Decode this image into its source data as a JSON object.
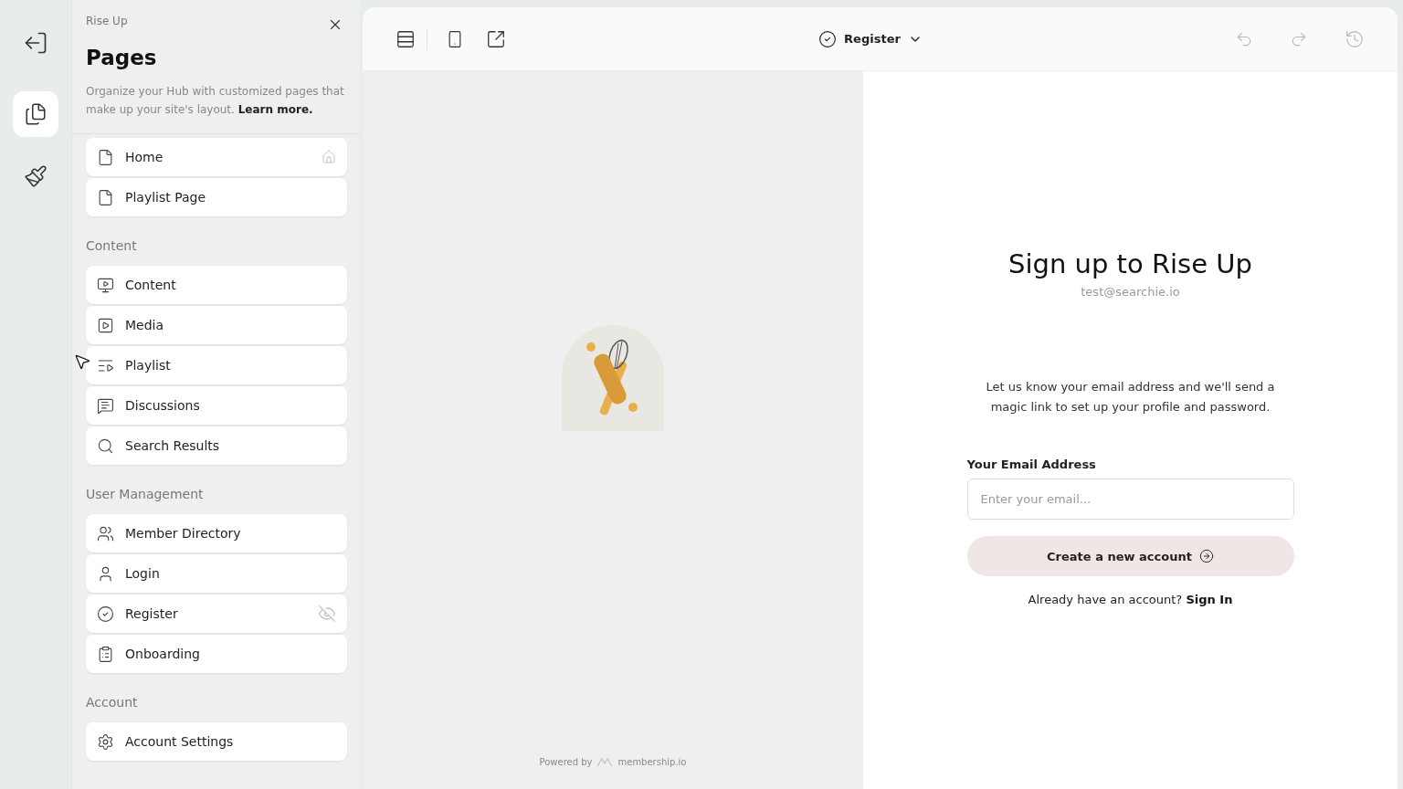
{
  "panel": {
    "site": "Rise Up",
    "title": "Pages",
    "description": "Organize your Hub with customized pages that make up your site's layout. **Learn more.**"
  },
  "sections": [
    {
      "items": [
        {
          "label": "Home",
          "home_page": true,
          "hidden": false
        },
        {
          "label": "Playlist Page",
          "home_page": false,
          "hidden": false
        }
      ]
    },
    {
      "heading": "Content",
      "items": [
        {
          "label": "Content",
          "home_page": false,
          "hidden": false
        },
        {
          "label": "Media",
          "home_page": false,
          "hidden": false
        },
        {
          "label": "Playlist",
          "home_page": false,
          "hidden": false
        },
        {
          "label": "Discussions",
          "home_page": false,
          "hidden": false
        },
        {
          "label": "Search Results",
          "home_page": false,
          "hidden": false
        }
      ]
    },
    {
      "heading": "User Management",
      "items": [
        {
          "label": "Member Directory",
          "home_page": false,
          "hidden": false
        },
        {
          "label": "Login",
          "home_page": false,
          "hidden": false
        },
        {
          "label": "Register",
          "home_page": false,
          "hidden": true
        },
        {
          "label": "Onboarding",
          "home_page": false,
          "hidden": false
        }
      ]
    },
    {
      "heading": "Account",
      "items": [
        {
          "label": "Account Settings",
          "home_page": false,
          "hidden": false
        }
      ]
    }
  ],
  "toolbar": {
    "page": "Register"
  },
  "preview": {
    "powered_by": "Powered by",
    "brand": "membership.io",
    "heading": "Sign up to Rise Up",
    "email_shown": "test@searchie.io",
    "intro": "Let us know your email address and we'll send a magic link to set up your profile and password.",
    "email_label": "Your Email Address",
    "email_placeholder": "Enter your email...",
    "submit": "Create a new account",
    "signin_prompt": "Already have an account?",
    "signin_link": "Sign In"
  }
}
